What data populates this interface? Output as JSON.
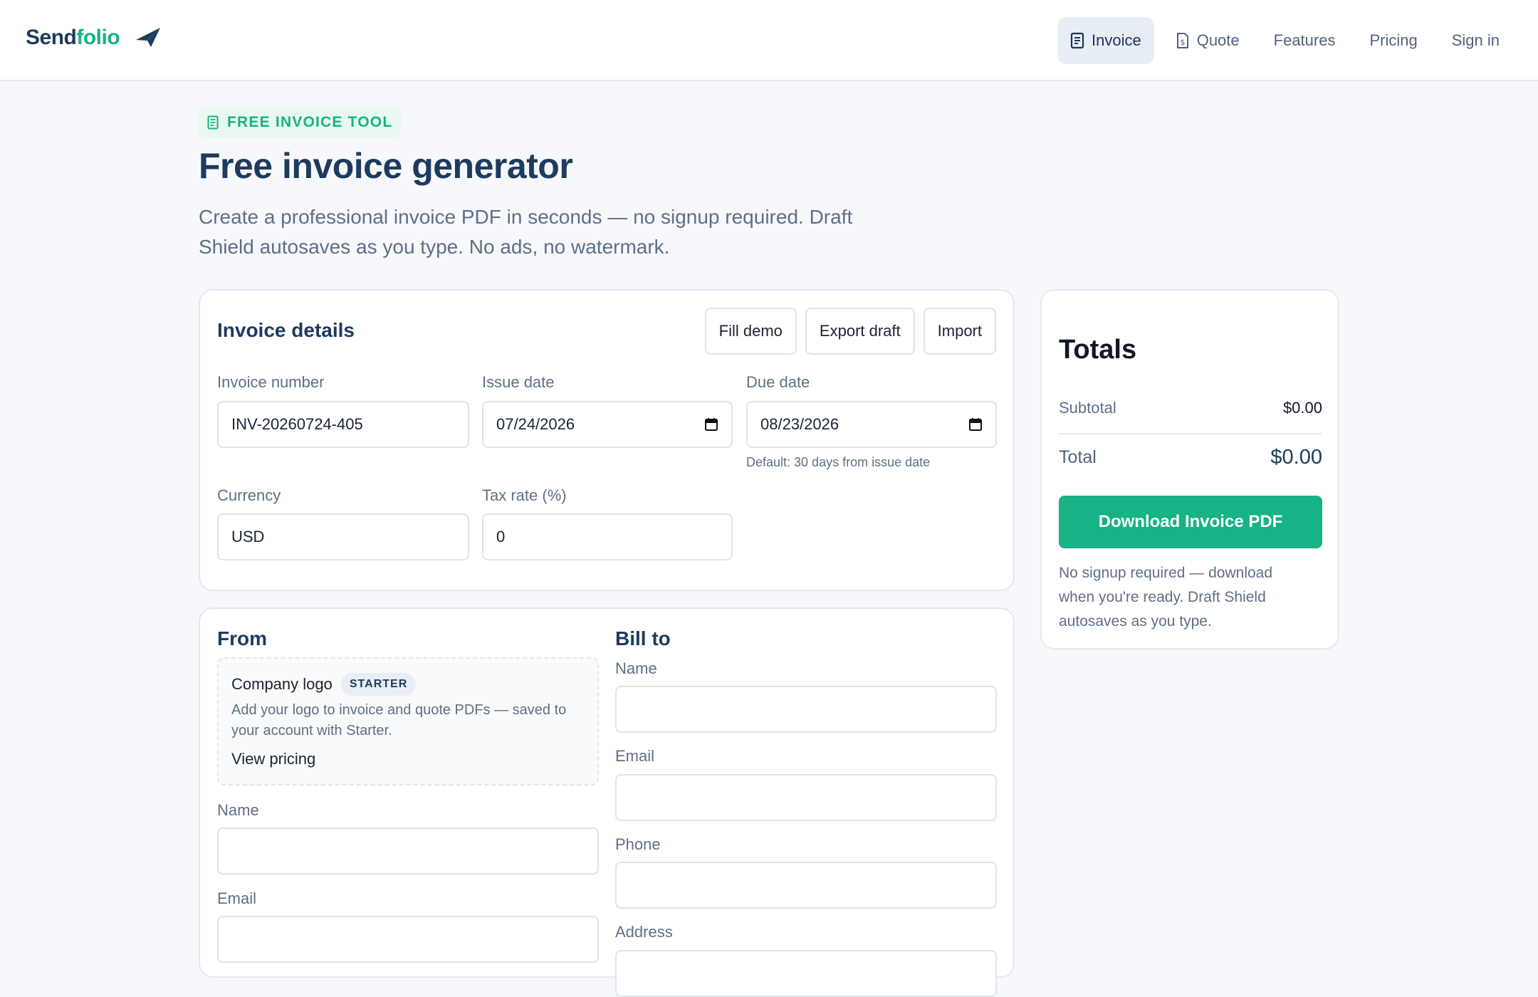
{
  "brand": {
    "name_part1": "Send",
    "name_part2": "folio",
    "icon": "paper-plane-icon"
  },
  "nav": {
    "items": [
      {
        "label": "Invoice",
        "icon": "invoice-doc-icon",
        "active": true
      },
      {
        "label": "Quote",
        "icon": "quote-doc-icon",
        "active": false
      },
      {
        "label": "Features"
      },
      {
        "label": "Pricing"
      },
      {
        "label": "Sign in"
      }
    ]
  },
  "hero": {
    "badge": "FREE INVOICE TOOL",
    "title": "Free invoice generator",
    "subtitle": "Create a professional invoice PDF in seconds — no signup required. Draft Shield autosaves as you type. No ads, no watermark."
  },
  "details": {
    "title": "Invoice details",
    "buttons": {
      "fill_demo": "Fill demo",
      "export_draft": "Export draft",
      "import": "Import"
    },
    "invoice_number": {
      "label": "Invoice number",
      "value": "INV-20260724-405"
    },
    "issue_date": {
      "label": "Issue date",
      "value": "07/24/2026"
    },
    "due_date": {
      "label": "Due date",
      "value": "08/23/2026",
      "hint": "Default: 30 days from issue date"
    },
    "currency": {
      "label": "Currency",
      "value": "USD"
    },
    "tax_rate": {
      "label": "Tax rate (%)",
      "value": "0"
    }
  },
  "from": {
    "title": "From",
    "logo": {
      "title": "Company logo",
      "tier": "STARTER",
      "description": "Add your logo to invoice and quote PDFs — saved to your account with Starter.",
      "link": "View pricing"
    },
    "name_label": "Name",
    "email_label": "Email"
  },
  "bill_to": {
    "title": "Bill to",
    "name_label": "Name",
    "email_label": "Email",
    "phone_label": "Phone",
    "address_label": "Address"
  },
  "totals": {
    "title": "Totals",
    "subtotal_label": "Subtotal",
    "subtotal_value": "$0.00",
    "total_label": "Total",
    "total_value": "$0.00",
    "download_label": "Download Invoice PDF",
    "note": "No signup required — download when you're ready. Draft Shield autosaves as you type."
  },
  "colors": {
    "accent": "#17b285",
    "brand_dark": "#1e3a5f",
    "background": "#f6f8fb"
  }
}
